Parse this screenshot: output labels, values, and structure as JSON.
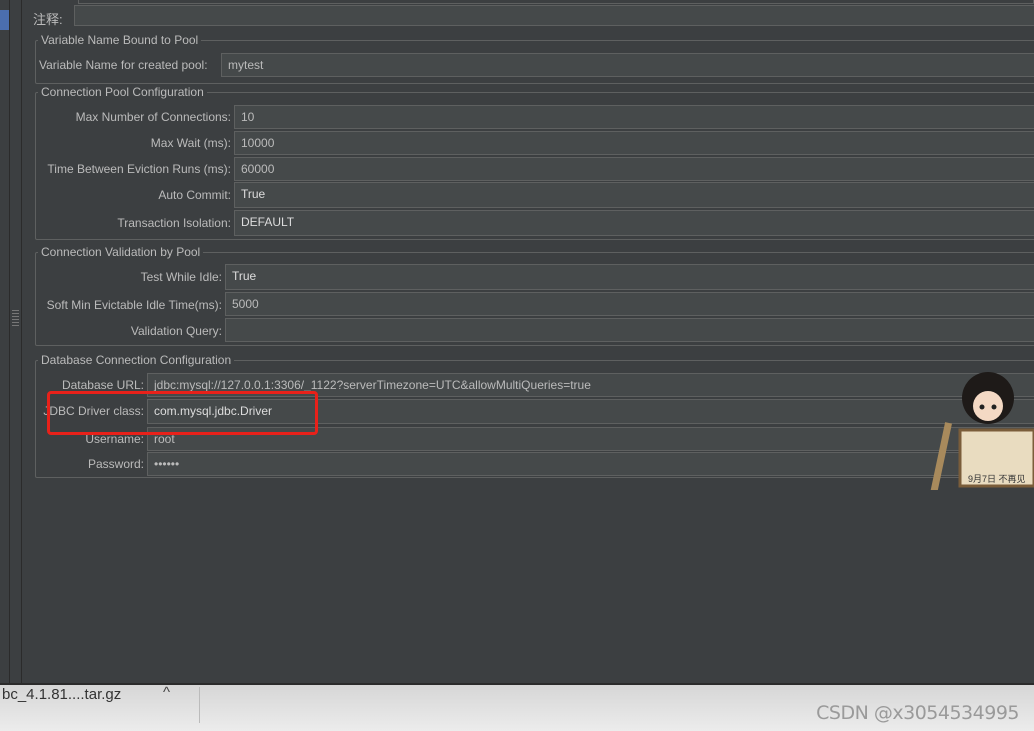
{
  "comment": {
    "label": "注释:",
    "value": ""
  },
  "groups": [
    {
      "title": "Variable Name Bound to Pool",
      "rows": [
        {
          "label": "Variable Name for created pool:",
          "value": "mytest"
        }
      ]
    },
    {
      "title": "Connection Pool Configuration",
      "rows": [
        {
          "label": "Max Number of Connections:",
          "value": "10"
        },
        {
          "label": "Max Wait (ms):",
          "value": "10000"
        },
        {
          "label": "Time Between Eviction Runs (ms):",
          "value": "60000"
        },
        {
          "label": "Auto Commit:",
          "value": "True"
        },
        {
          "label": "Transaction Isolation:",
          "value": "DEFAULT"
        }
      ]
    },
    {
      "title": "Connection Validation by Pool",
      "rows": [
        {
          "label": "Test While Idle:",
          "value": "True"
        },
        {
          "label": "Soft Min Evictable Idle Time(ms):",
          "value": "5000"
        },
        {
          "label": "Validation Query:",
          "value": ""
        }
      ]
    },
    {
      "title": "Database Connection Configuration",
      "rows": [
        {
          "label": "Database URL:",
          "value": "jdbc:mysql://127.0.0.1:3306/_1122?serverTimezone=UTC&allowMultiQueries=true"
        },
        {
          "label": "JDBC Driver class:",
          "value": "com.mysql.jdbc.Driver"
        },
        {
          "label": "Username:",
          "value": "root"
        },
        {
          "label": "Password:",
          "value": "••••••"
        }
      ]
    }
  ],
  "highlight_color": "#e8211a",
  "downloads": {
    "file": "bc_4.1.81....tar.gz",
    "caret": "^"
  },
  "watermark": "CSDN @x3054534995",
  "sticker": {
    "text": "9月7日 不再见"
  }
}
